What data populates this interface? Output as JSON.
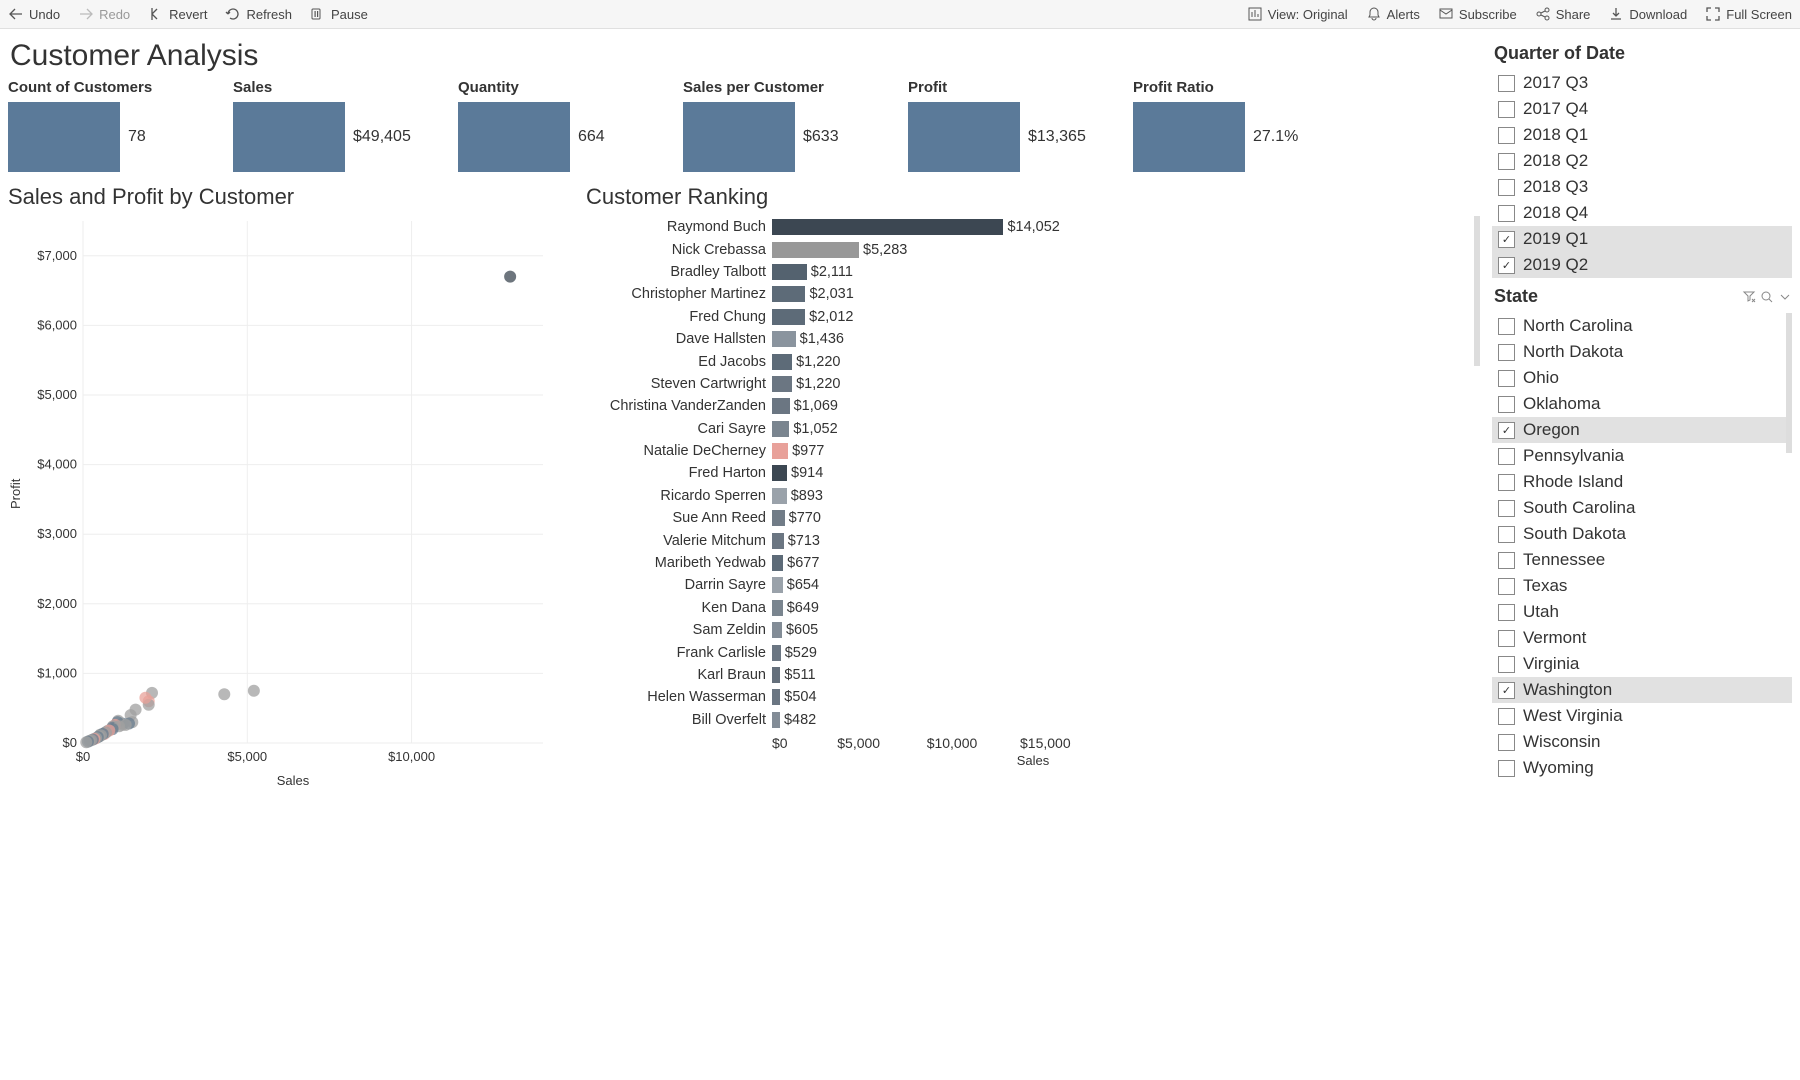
{
  "toolbar": {
    "undo": "Undo",
    "redo": "Redo",
    "revert": "Revert",
    "refresh": "Refresh",
    "pause": "Pause",
    "view": "View: Original",
    "alerts": "Alerts",
    "subscribe": "Subscribe",
    "share": "Share",
    "download": "Download",
    "fullscreen": "Full Screen"
  },
  "page_title": "Customer Analysis",
  "kpis": [
    {
      "label": "Count of Customers",
      "value": "78"
    },
    {
      "label": "Sales",
      "value": "$49,405"
    },
    {
      "label": "Quantity",
      "value": "664"
    },
    {
      "label": "Sales per Customer",
      "value": "$633"
    },
    {
      "label": "Profit",
      "value": "$13,365"
    },
    {
      "label": "Profit Ratio",
      "value": "27.1%"
    }
  ],
  "scatter": {
    "title": "Sales and Profit by Customer",
    "xlabel": "Sales",
    "ylabel": "Profit"
  },
  "ranking": {
    "title": "Customer Ranking",
    "xlabel": "Sales"
  },
  "filters": {
    "quarter": {
      "title": "Quarter of Date",
      "items": [
        {
          "label": "2017 Q3",
          "checked": false
        },
        {
          "label": "2017 Q4",
          "checked": false
        },
        {
          "label": "2018 Q1",
          "checked": false
        },
        {
          "label": "2018 Q2",
          "checked": false
        },
        {
          "label": "2018 Q3",
          "checked": false
        },
        {
          "label": "2018 Q4",
          "checked": false
        },
        {
          "label": "2019 Q1",
          "checked": true
        },
        {
          "label": "2019 Q2",
          "checked": true
        }
      ]
    },
    "state": {
      "title": "State",
      "items": [
        {
          "label": "North Carolina",
          "checked": false
        },
        {
          "label": "North Dakota",
          "checked": false
        },
        {
          "label": "Ohio",
          "checked": false
        },
        {
          "label": "Oklahoma",
          "checked": false
        },
        {
          "label": "Oregon",
          "checked": true
        },
        {
          "label": "Pennsylvania",
          "checked": false
        },
        {
          "label": "Rhode Island",
          "checked": false
        },
        {
          "label": "South Carolina",
          "checked": false
        },
        {
          "label": "South Dakota",
          "checked": false
        },
        {
          "label": "Tennessee",
          "checked": false
        },
        {
          "label": "Texas",
          "checked": false
        },
        {
          "label": "Utah",
          "checked": false
        },
        {
          "label": "Vermont",
          "checked": false
        },
        {
          "label": "Virginia",
          "checked": false
        },
        {
          "label": "Washington",
          "checked": true
        },
        {
          "label": "West Virginia",
          "checked": false
        },
        {
          "label": "Wisconsin",
          "checked": false
        },
        {
          "label": "Wyoming",
          "checked": false
        }
      ]
    }
  },
  "chart_data": [
    {
      "type": "scatter",
      "title": "Sales and Profit by Customer",
      "xlabel": "Sales",
      "ylabel": "Profit",
      "xlim": [
        0,
        14000
      ],
      "ylim": [
        0,
        7500
      ],
      "x_ticks": [
        0,
        5000,
        10000
      ],
      "y_ticks": [
        0,
        1000,
        2000,
        3000,
        4000,
        5000,
        6000,
        7000
      ],
      "series": [
        {
          "name": "Customers",
          "x": [
            13000,
            5200,
            2100,
            2000,
            2000,
            1450,
            1200,
            1200,
            1070,
            1050,
            980,
            910,
            890,
            770,
            710,
            680,
            650,
            650,
            600,
            530,
            510,
            500,
            480,
            4300,
            1900,
            1600,
            1500,
            1400,
            1300,
            1100,
            900,
            800,
            700,
            600,
            550,
            500,
            450,
            400,
            350,
            300,
            250,
            200,
            150,
            100
          ],
          "y": [
            6700,
            750,
            720,
            600,
            550,
            400,
            280,
            260,
            320,
            300,
            260,
            240,
            220,
            180,
            160,
            150,
            140,
            130,
            130,
            120,
            110,
            100,
            95,
            700,
            650,
            480,
            300,
            280,
            260,
            240,
            200,
            180,
            150,
            130,
            110,
            95,
            85,
            70,
            60,
            50,
            40,
            30,
            20,
            10
          ]
        }
      ],
      "colors": [
        "#6a7d8f",
        "#a0a0a0",
        "#e8a19a"
      ]
    },
    {
      "type": "bar",
      "orientation": "horizontal",
      "title": "Customer Ranking",
      "xlabel": "Sales",
      "xlim": [
        0,
        17000
      ],
      "x_ticks": [
        0,
        5000,
        10000,
        15000
      ],
      "categories": [
        "Raymond Buch",
        "Nick Crebassa",
        "Bradley Talbott",
        "Christopher Martinez",
        "Fred Chung",
        "Dave Hallsten",
        "Ed Jacobs",
        "Steven Cartwright",
        "Christina VanderZanden",
        "Cari Sayre",
        "Natalie DeCherney",
        "Fred Harton",
        "Ricardo Sperren",
        "Sue Ann Reed",
        "Valerie Mitchum",
        "Maribeth Yedwab",
        "Darrin Sayre",
        "Ken Dana",
        "Sam Zeldin",
        "Frank Carlisle",
        "Karl Braun",
        "Helen Wasserman",
        "Bill Overfelt"
      ],
      "values": [
        14052,
        5283,
        2111,
        2031,
        2012,
        1436,
        1220,
        1220,
        1069,
        1052,
        977,
        914,
        893,
        770,
        713,
        677,
        654,
        649,
        605,
        529,
        511,
        504,
        482
      ],
      "labels": [
        "$14,052",
        "$5,283",
        "$2,111",
        "$2,031",
        "$2,012",
        "$1,436",
        "$1,220",
        "$1,220",
        "$1,069",
        "$1,052",
        "$977",
        "$914",
        "$893",
        "$770",
        "$713",
        "$677",
        "$654",
        "$649",
        "$605",
        "$529",
        "$511",
        "$504",
        "$482"
      ],
      "bar_colors": [
        "#3c4752",
        "#989898",
        "#54626f",
        "#5d6b78",
        "#5d6b78",
        "#8a949e",
        "#5d6b78",
        "#6b7682",
        "#6b7682",
        "#7a858f",
        "#e8a19a",
        "#3c4752",
        "#9aa2aa",
        "#717c87",
        "#6b7682",
        "#5d6b78",
        "#9aa2aa",
        "#7a858f",
        "#828c96",
        "#6b7682",
        "#646f7b",
        "#6b7682",
        "#828c96"
      ]
    }
  ]
}
